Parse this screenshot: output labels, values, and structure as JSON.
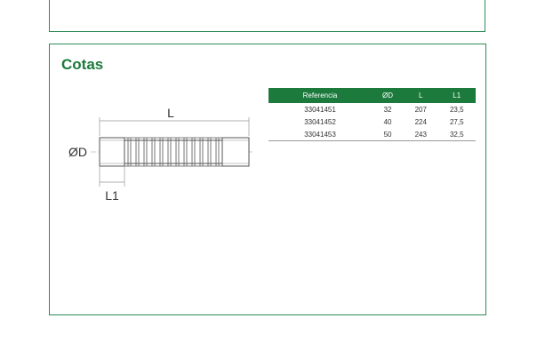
{
  "section": {
    "title": "Cotas"
  },
  "drawing": {
    "label_L": "L",
    "label_D": "ØD",
    "label_L1": "L1"
  },
  "table": {
    "headers": [
      "Referencia",
      "ØD",
      "L",
      "L1"
    ],
    "rows": [
      [
        "33041451",
        "32",
        "207",
        "23,5"
      ],
      [
        "33041452",
        "40",
        "224",
        "27,5"
      ],
      [
        "33041453",
        "50",
        "243",
        "32,5"
      ]
    ]
  },
  "colors": {
    "accent": "#1b7a3c",
    "border": "#2e8b57"
  }
}
